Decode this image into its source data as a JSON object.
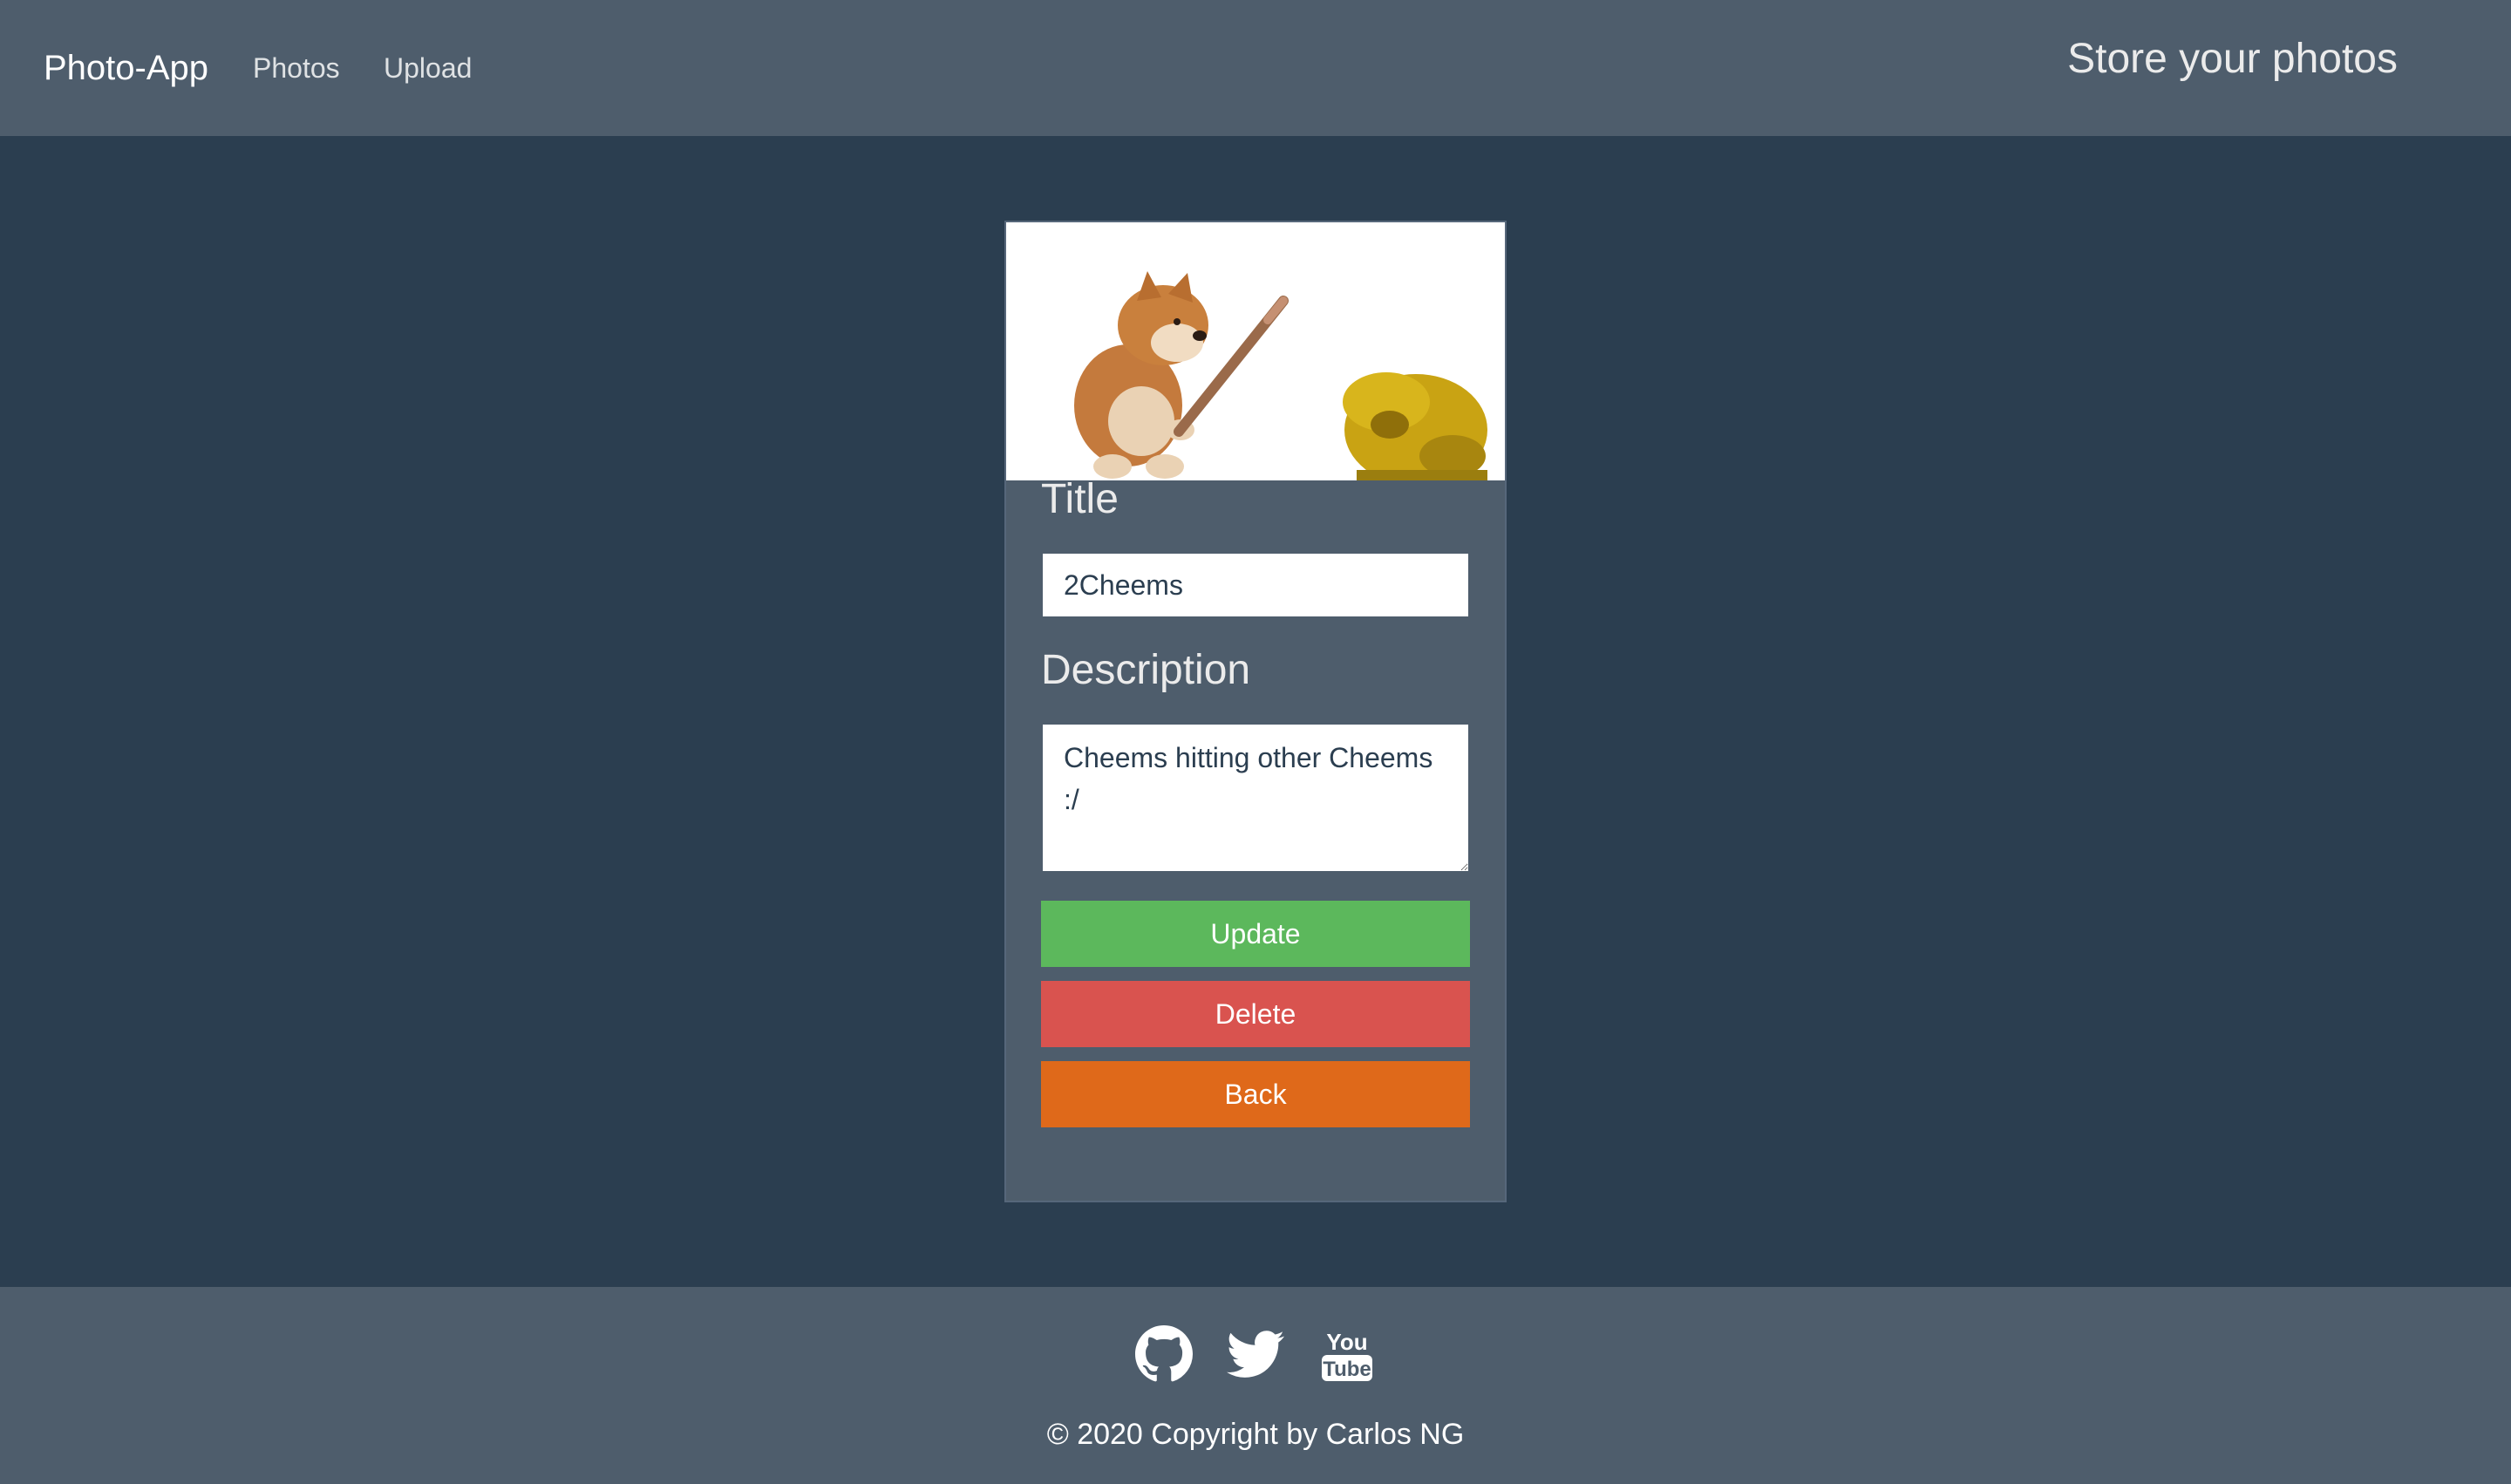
{
  "navbar": {
    "brand": "Photo-App",
    "links": [
      {
        "label": "Photos"
      },
      {
        "label": "Upload"
      }
    ],
    "tagline": "Store your photos"
  },
  "photo": {
    "title_label": "Title",
    "title_value": "2Cheems",
    "description_label": "Description",
    "description_value": "Cheems hitting other Cheems :/"
  },
  "actions": {
    "update_label": "Update",
    "delete_label": "Delete",
    "back_label": "Back"
  },
  "footer": {
    "social_icons": [
      "github-icon",
      "twitter-icon",
      "youtube-icon"
    ],
    "copyright": "© 2020 Copyright by Carlos NG"
  },
  "colors": {
    "background": "#2b3e50",
    "panel": "#4e5d6c",
    "update": "#5cb85c",
    "delete": "#d9534f",
    "back": "#df691a"
  }
}
